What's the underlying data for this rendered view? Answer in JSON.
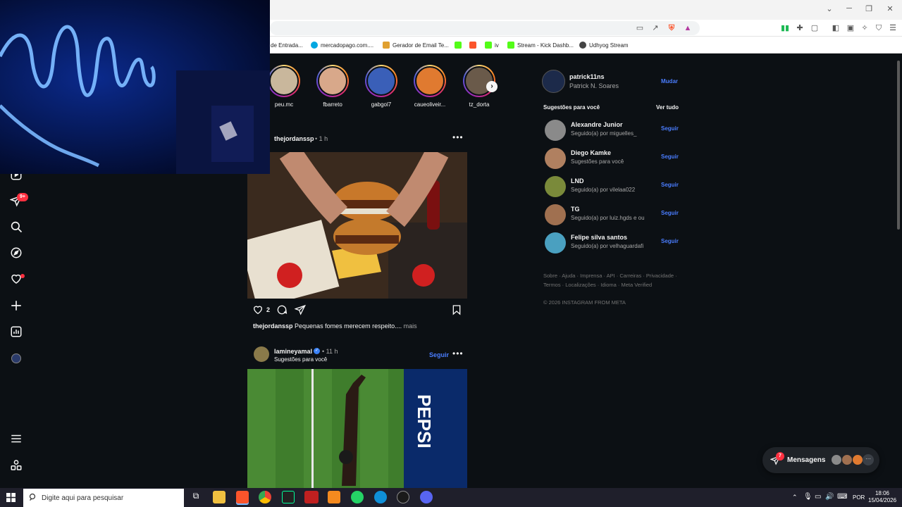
{
  "browser": {
    "bookmarks": [
      {
        "label": "de Entrada...",
        "icon": "none",
        "color": "#ffffff"
      },
      {
        "label": "mercadopago.com....",
        "icon": "mercadopago-icon",
        "color": "#00a7e1"
      },
      {
        "label": "Gerador de Email Te...",
        "icon": "pencil-icon",
        "color": "#e0a030"
      },
      {
        "label": "",
        "icon": "kick-icon",
        "color": "#53fc18"
      },
      {
        "label": "",
        "icon": "brave-icon",
        "color": "#fb542b"
      },
      {
        "label": "iv",
        "icon": "kick-icon",
        "color": "#53fc18"
      },
      {
        "label": "Stream - Kick Dashb...",
        "icon": "kick-icon",
        "color": "#53fc18"
      },
      {
        "label": "Udhyog Stream",
        "icon": "globe-icon",
        "color": "#444444"
      }
    ]
  },
  "left_nav": {
    "notifications_badge": "9+"
  },
  "stories": [
    {
      "name": "peu.mc",
      "color": "#c9b79c"
    },
    {
      "name": "fbarreto",
      "color": "#d8a88a"
    },
    {
      "name": "gabgol7",
      "color": "#3a5fb8"
    },
    {
      "name": "caueoliveir...",
      "color": "#e07a30"
    },
    {
      "name": "tz_dorta",
      "color": "#6a5a4a"
    }
  ],
  "post1": {
    "user": "thejordanssp",
    "time": "1 h",
    "likes": "2",
    "caption_user": "thejordanssp",
    "caption_text": "Pequenas fomes merecem respeito....",
    "more": "mais"
  },
  "post2": {
    "user": "lamineyamal",
    "time": "11 h",
    "subtitle": "Sugestões para você",
    "follow": "Seguir",
    "billboard": "PEPSI"
  },
  "profile": {
    "username": "patrick11ns",
    "full_name": "Patrick N. Soares",
    "switch": "Mudar"
  },
  "suggestions": {
    "title": "Sugestões para você",
    "see_all": "Ver tudo",
    "items": [
      {
        "name": "Alexandre Junior",
        "sub": "Seguido(a) por miguelles_",
        "follow": "Seguir",
        "color": "#8a8a8a"
      },
      {
        "name": "Diego Kamke",
        "sub": "Sugestões para você",
        "follow": "Seguir",
        "color": "#b08060"
      },
      {
        "name": "LND",
        "sub": "Seguido(a) por vilelaa022",
        "follow": "Seguir",
        "color": "#7a8a3a"
      },
      {
        "name": "TG",
        "sub": "Seguido(a) por luiz.hgds e ou",
        "follow": "Seguir",
        "color": "#a07050"
      },
      {
        "name": "Felipe silva santos",
        "sub": "Seguido(a) por velhaguardafi",
        "follow": "Seguir",
        "color": "#4aa0c0"
      }
    ]
  },
  "footer": {
    "line1": "Sobre · Ajuda · Imprensa · API · Carreiras · Privacidade ·",
    "line2": "Termos · Localizações · Idioma · Meta Verified",
    "copyright": "© 2026 INSTAGRAM FROM META"
  },
  "messages": {
    "label": "Mensagens",
    "badge": "7"
  },
  "taskbar": {
    "search_placeholder": "Digite aqui para pesquisar",
    "lang": "POR",
    "time": "18:06",
    "date": "15/04/2026"
  }
}
